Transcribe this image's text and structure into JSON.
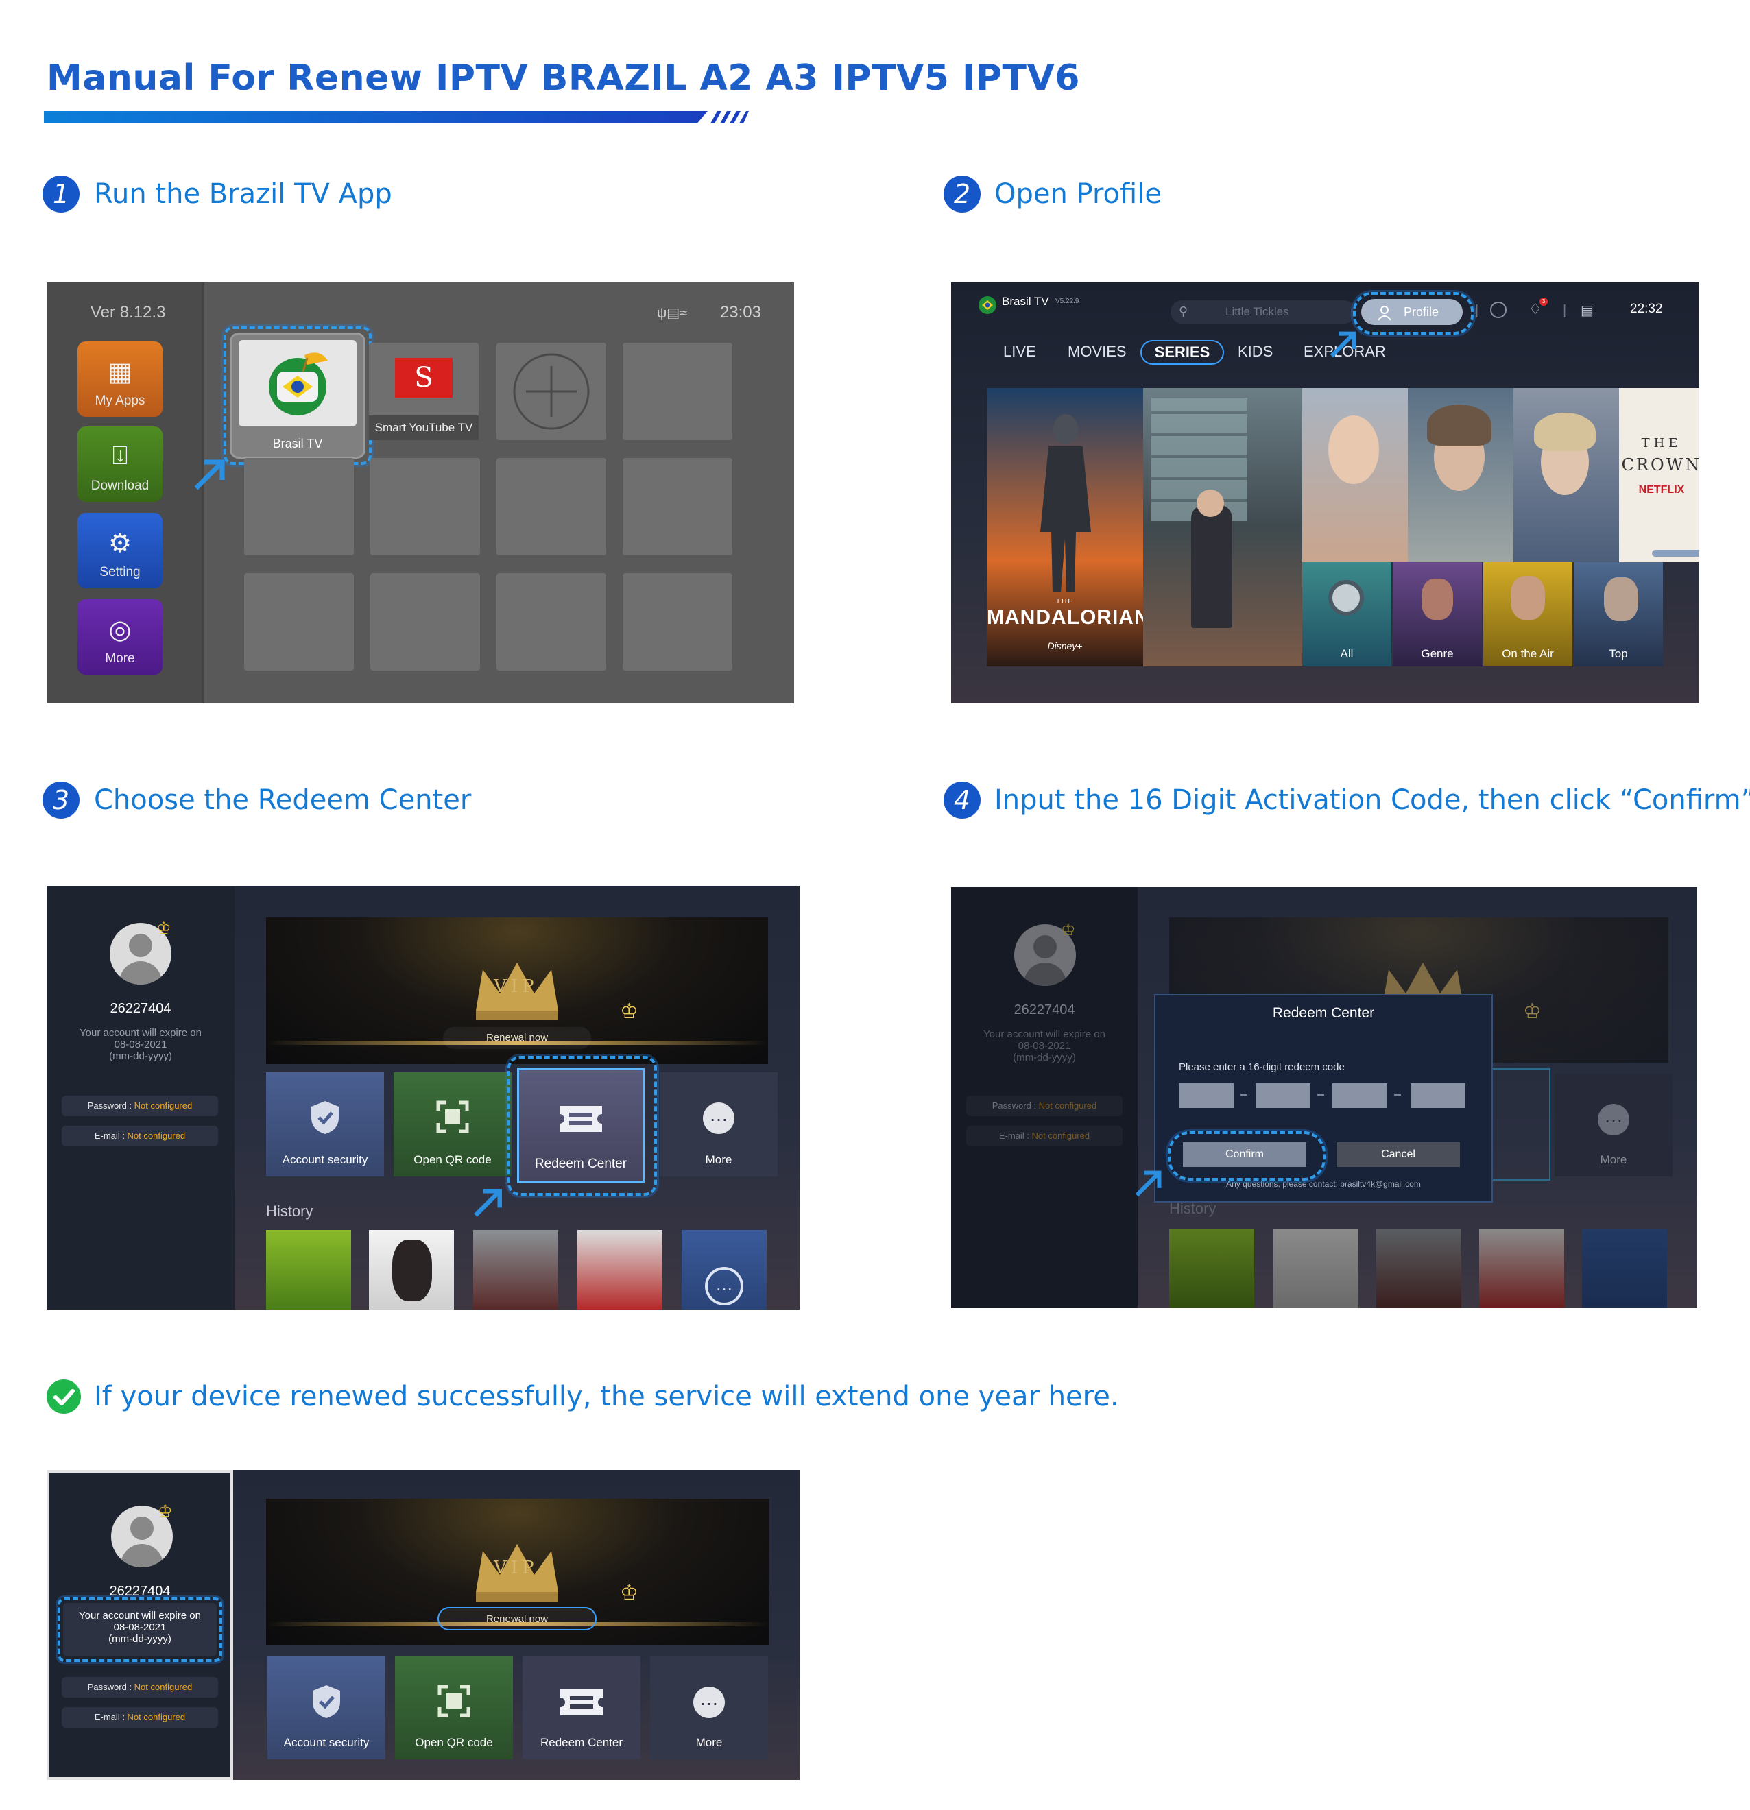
{
  "header": {
    "title": "Manual For Renew IPTV BRAZIL A2 A3 IPTV5 IPTV6"
  },
  "steps": [
    {
      "number": "1",
      "label": "Run the Brazil TV App"
    },
    {
      "number": "2",
      "label": "Open Profile"
    },
    {
      "number": "3",
      "label": "Choose the Redeem Center"
    },
    {
      "number": "4",
      "label": "Input the 16 Digit Activation Code, then click “Confirm”"
    }
  ],
  "success_note": "If your device renewed successfully, the service will extend one year here.",
  "launcher": {
    "version": "Ver 8.12.3",
    "time": "23:03",
    "side_items": [
      {
        "label": "My Apps",
        "icon": "grid-icon",
        "color": "#c2651c"
      },
      {
        "label": "Download",
        "icon": "download-icon",
        "color": "#3f7a1c"
      },
      {
        "label": "Setting",
        "icon": "gear-icon",
        "color": "#1d4eb8"
      },
      {
        "label": "More",
        "icon": "more-circle-icon",
        "color": "#5a2197"
      }
    ],
    "apps": [
      {
        "label": "Brasil TV"
      },
      {
        "label": "Smart YouTube TV"
      }
    ]
  },
  "series_screen": {
    "app_name": "Brasil TV",
    "app_version": "V5.22.9",
    "search_placeholder": "Little Tickles",
    "profile_label": "Profile",
    "time": "22:32",
    "notification_count": "3",
    "nav": [
      "LIVE",
      "MOVIES",
      "SERIES",
      "KIDS",
      "EXPLORAR"
    ],
    "active_nav": "SERIES",
    "posters": {
      "mandalorian_title": "MANDALORIAN",
      "mandalorian_the": "THE",
      "mandalorian_brand": "Disney+",
      "crown_the": "THE",
      "crown_title": "CROWN",
      "crown_brand": "NETFLIX"
    },
    "categories": [
      "All",
      "Genre",
      "On the Air",
      "Top"
    ]
  },
  "account": {
    "id": "26227404",
    "expire_line1": "Your account will expire on",
    "expire_date": "08-08-2021",
    "expire_format": "(mm-dd-yyyy)",
    "password_label": "Password : ",
    "email_label": "E-mail : ",
    "not_configured": "Not configured",
    "vip_text": "VIP",
    "renew_label": "Renewal now",
    "cards": [
      {
        "label": "Account security",
        "icon": "shield-icon",
        "color": "#3b4d78"
      },
      {
        "label": "Open QR code",
        "icon": "qr-scan-icon",
        "color": "#2e5a2e"
      },
      {
        "label": "Redeem Center",
        "icon": "ticket-icon",
        "color": "#4a4a66"
      },
      {
        "label": "More",
        "icon": "more-icon",
        "color": "#33374a"
      }
    ],
    "history_label": "History"
  },
  "redeem_dialog": {
    "title": "Redeem Center",
    "prompt": "Please enter a 16-digit redeem code",
    "confirm": "Confirm",
    "cancel": "Cancel",
    "footer": "Any questions, please contact: brasiltv4k@gmail.com"
  },
  "colors": {
    "accent_blue": "#1d5fc9",
    "step_text": "#1279d4",
    "success_green": "#1fb64b",
    "highlight_dash": "#2f9ae8",
    "warning_orange": "#f0a520"
  }
}
